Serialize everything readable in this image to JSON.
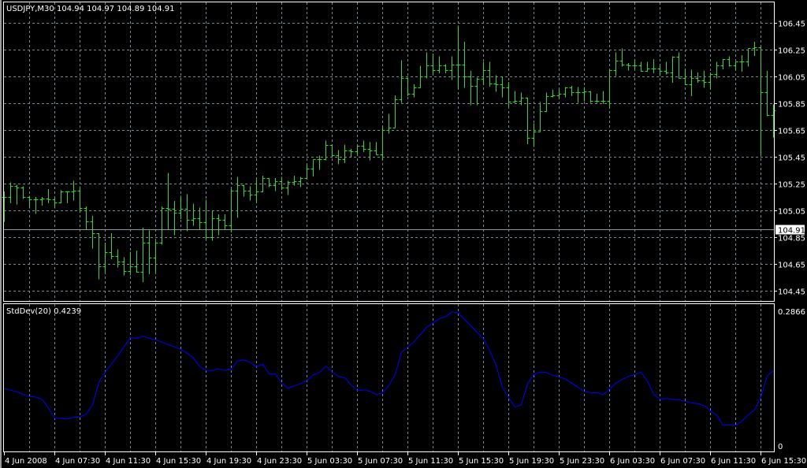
{
  "header": {
    "symbol": "USDJPY,M30",
    "ohlc_readout": "104.94 104.97 104.89 104.91"
  },
  "indicator_header": {
    "label": "StdDev(20) 0.4239"
  },
  "colors": {
    "background": "#000000",
    "bars": "#22e41c",
    "indicator_line": "#0000ff",
    "grid": "#7b8694",
    "axis": "#ffffff"
  },
  "current_price_label": "104.91",
  "chart_data": [
    {
      "type": "ohlc",
      "title": "USDJPY,M30",
      "ylim": [
        104.45,
        106.45
      ],
      "y_ticks": [
        "106.45",
        "106.25",
        "106.05",
        "105.85",
        "105.65",
        "105.45",
        "105.25",
        "105.05",
        "104.85",
        "104.65",
        "104.45"
      ],
      "current_price": 104.91,
      "x_ticks": [
        "4 Jun 2008",
        "4 Jun 07:30",
        "4 Jun 11:30",
        "4 Jun 15:30",
        "4 Jun 19:30",
        "4 Jun 23:30",
        "5 Jun 03:30",
        "5 Jun 07:30",
        "5 Jun 11:30",
        "5 Jun 15:30",
        "5 Jun 19:30",
        "5 Jun 23:30",
        "6 Jun 03:30",
        "6 Jun 07:30",
        "6 Jun 11:30",
        "6 Jun 15:30"
      ],
      "bars_per_x_tick": 8,
      "grid": true,
      "high": [
        105.19,
        105.26,
        105.24,
        105.23,
        105.16,
        105.15,
        105.15,
        105.21,
        105.14,
        105.2,
        105.19,
        105.27,
        105.23,
        105.08,
        105.01,
        104.88,
        104.81,
        104.88,
        104.76,
        104.7,
        104.74,
        104.75,
        104.92,
        104.9,
        104.82,
        105.08,
        105.33,
        105.12,
        105.16,
        105.17,
        105.1,
        105.07,
        105.13,
        105.05,
        105.02,
        105.02,
        105.21,
        105.3,
        105.24,
        105.23,
        105.28,
        105.31,
        105.29,
        105.29,
        105.3,
        105.27,
        105.31,
        105.3,
        105.39,
        105.43,
        105.46,
        105.57,
        105.54,
        105.5,
        105.54,
        105.51,
        105.53,
        105.57,
        105.56,
        105.56,
        105.67,
        105.77,
        105.91,
        106.17,
        106.04,
        105.99,
        106.13,
        106.23,
        106.22,
        106.2,
        106.14,
        106.2,
        106.43,
        106.31,
        106.09,
        106.04,
        106.16,
        106.16,
        106.06,
        106.05,
        106.01,
        105.94,
        105.93,
        105.88,
        105.7,
        105.86,
        105.93,
        105.95,
        105.95,
        105.97,
        105.98,
        105.97,
        105.97,
        105.93,
        105.92,
        105.94,
        106.1,
        106.23,
        106.26,
        106.15,
        106.18,
        106.16,
        106.16,
        106.18,
        106.13,
        106.16,
        106.2,
        106.23,
        106.11,
        106.1,
        106.08,
        106.09,
        106.08,
        106.16,
        106.18,
        106.2,
        106.16,
        106.21,
        106.26,
        106.31,
        106.26,
        106.09,
        105.84
      ],
      "low": [
        104.97,
        105.11,
        105.1,
        105.14,
        105.07,
        105.03,
        105.09,
        105.11,
        105.07,
        105.11,
        105.11,
        105.13,
        105.04,
        104.91,
        104.77,
        104.54,
        104.59,
        104.69,
        104.63,
        104.57,
        104.57,
        104.59,
        104.52,
        104.58,
        104.59,
        104.8,
        104.91,
        104.87,
        104.99,
        104.9,
        104.94,
        104.91,
        104.84,
        104.83,
        104.87,
        104.91,
        104.89,
        105.0,
        105.16,
        105.13,
        105.11,
        105.19,
        105.23,
        105.2,
        105.21,
        105.17,
        105.24,
        105.23,
        105.3,
        105.31,
        105.36,
        105.43,
        105.45,
        105.4,
        105.41,
        105.45,
        105.47,
        105.49,
        105.43,
        105.47,
        105.43,
        105.63,
        105.68,
        105.86,
        105.91,
        105.9,
        105.97,
        106.04,
        106.07,
        106.08,
        106.08,
        106.03,
        105.96,
        105.97,
        105.84,
        105.84,
        105.99,
        105.98,
        105.94,
        105.9,
        105.83,
        105.86,
        105.84,
        105.55,
        105.53,
        105.64,
        105.8,
        105.9,
        105.89,
        105.9,
        105.91,
        105.86,
        105.87,
        105.86,
        105.86,
        105.85,
        105.82,
        106.06,
        106.13,
        106.1,
        106.11,
        106.09,
        106.1,
        106.08,
        106.06,
        106.07,
        106.01,
        106.04,
        105.99,
        105.91,
        106.01,
        105.97,
        105.96,
        106.04,
        106.11,
        106.13,
        106.1,
        106.09,
        106.13,
        106.21,
        105.46,
        105.76,
        105.6
      ],
      "close": [
        105.15,
        105.23,
        105.22,
        105.15,
        105.13,
        105.13,
        105.14,
        105.13,
        105.11,
        105.19,
        105.19,
        105.2,
        105.07,
        104.97,
        104.88,
        104.63,
        104.74,
        104.71,
        104.67,
        104.6,
        104.63,
        104.59,
        104.81,
        104.7,
        104.81,
        105.07,
        105.06,
        105.03,
        105.06,
        104.98,
        104.99,
        104.96,
        104.85,
        104.99,
        104.98,
        104.94,
        105.2,
        105.24,
        105.2,
        105.17,
        105.19,
        105.29,
        105.24,
        105.27,
        105.22,
        105.26,
        105.27,
        105.29,
        105.36,
        105.43,
        105.43,
        105.54,
        105.46,
        105.43,
        105.5,
        105.49,
        105.53,
        105.51,
        105.5,
        105.47,
        105.65,
        105.67,
        105.88,
        106.04,
        105.92,
        105.97,
        106.05,
        106.13,
        106.1,
        106.13,
        106.1,
        106.14,
        106.14,
        106.05,
        105.98,
        106.03,
        106.1,
        106.0,
        105.99,
        105.97,
        105.86,
        105.87,
        105.89,
        105.59,
        105.64,
        105.79,
        105.9,
        105.91,
        105.92,
        105.97,
        105.93,
        105.93,
        105.94,
        105.87,
        105.87,
        105.87,
        106.1,
        106.17,
        106.14,
        106.13,
        106.13,
        106.09,
        106.11,
        106.11,
        106.09,
        106.08,
        106.2,
        106.04,
        105.99,
        106.04,
        106.02,
        106.01,
        106.07,
        106.13,
        106.18,
        106.13,
        106.16,
        106.16,
        106.26,
        106.27,
        105.93,
        105.76,
        105.8
      ]
    },
    {
      "type": "line",
      "title": "StdDev(20) 0.4239",
      "ylim": [
        0,
        0.2866
      ],
      "y_ticks": [
        "0.2866",
        "0"
      ],
      "series": [
        {
          "name": "StdDev(20)",
          "values": [
            0.123,
            0.119,
            0.116,
            0.11,
            0.106,
            0.105,
            0.1,
            0.082,
            0.061,
            0.061,
            0.059,
            0.063,
            0.063,
            0.07,
            0.089,
            0.136,
            0.157,
            0.174,
            0.191,
            0.21,
            0.228,
            0.227,
            0.231,
            0.227,
            0.224,
            0.219,
            0.214,
            0.209,
            0.204,
            0.196,
            0.186,
            0.168,
            0.16,
            0.16,
            0.164,
            0.16,
            0.163,
            0.18,
            0.182,
            0.177,
            0.168,
            0.173,
            0.153,
            0.153,
            0.134,
            0.123,
            0.128,
            0.133,
            0.139,
            0.151,
            0.156,
            0.169,
            0.157,
            0.148,
            0.145,
            0.13,
            0.118,
            0.12,
            0.117,
            0.11,
            0.114,
            0.129,
            0.152,
            0.198,
            0.209,
            0.22,
            0.235,
            0.25,
            0.259,
            0.268,
            0.272,
            0.282,
            0.28,
            0.266,
            0.253,
            0.239,
            0.226,
            0.201,
            0.171,
            0.125,
            0.103,
            0.084,
            0.089,
            0.133,
            0.152,
            0.157,
            0.156,
            0.15,
            0.147,
            0.142,
            0.134,
            0.125,
            0.116,
            0.114,
            0.114,
            0.11,
            0.122,
            0.134,
            0.141,
            0.148,
            0.152,
            0.156,
            0.138,
            0.11,
            0.1,
            0.102,
            0.1,
            0.099,
            0.096,
            0.093,
            0.091,
            0.087,
            0.076,
            0.067,
            0.046,
            0.047,
            0.046,
            0.055,
            0.068,
            0.078,
            0.106,
            0.149,
            0.16
          ]
        }
      ],
      "grid": true
    }
  ]
}
